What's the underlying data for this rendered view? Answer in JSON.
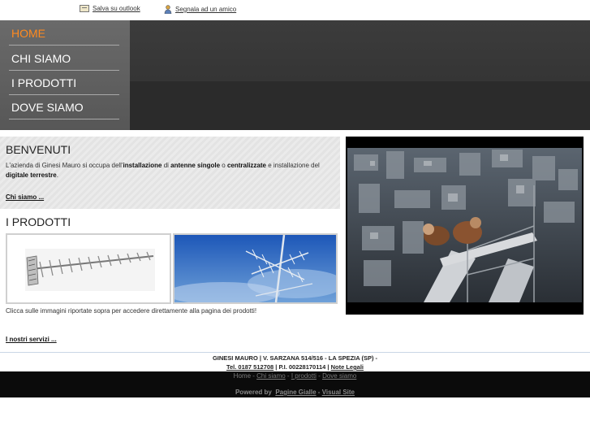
{
  "topbar": {
    "outlook_label": "Salva su outlook",
    "friend_label": "Segnala ad un amico"
  },
  "nav": {
    "items": [
      {
        "label": "HOME",
        "active": true
      },
      {
        "label": "CHI SIAMO"
      },
      {
        "label": "I PRODOTTI"
      },
      {
        "label": "DOVE SIAMO"
      }
    ]
  },
  "welcome": {
    "title": "BENVENUTI",
    "text_parts": {
      "p1": "L'azienda di Ginesi Mauro si occupa dell'",
      "b1": "installazione",
      "p2": " di ",
      "b2": "antenne singole",
      "p3": " o ",
      "b3": "centralizzate",
      "p4": " e installazione del ",
      "b4": "digitale terrestre",
      "p5": "."
    },
    "more_link": "Chi siamo ..."
  },
  "products": {
    "title": "I PRODOTTI",
    "caption": "Clicca sulle immagini riportate sopra per accedere direttamente alla pagina dei prodotti!",
    "services_link": "I nostri servizi ..."
  },
  "footer": {
    "address": "GINESI MAURO | V. SARZANA 514/516 - LA SPEZIA (SP) -",
    "tel": "Tel. 0187 512708",
    "piva": " | P.I. 00228170114 | ",
    "legal": "Note Legali",
    "nav": [
      "Home",
      "Chi siamo",
      "I prodotti",
      "Dove siamo"
    ],
    "nav_sep": " - ",
    "powered_by": "Powered by",
    "pagine_gialle": "Pagine Gialle",
    "powered_sep": " - ",
    "visual_site": "Visual Site"
  },
  "colors": {
    "nav_active": "#ff8a1f",
    "nav_bg": "#636363",
    "header_bg": "#333333",
    "footer_bg": "#0b0b0b"
  }
}
